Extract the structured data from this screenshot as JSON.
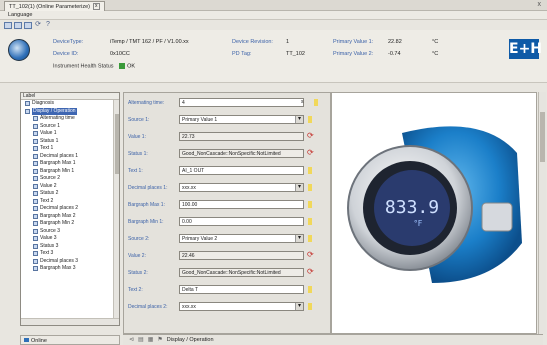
{
  "window": {
    "tab_title": "TT_102(1) (Online Parameterize)",
    "tab_close": "x",
    "close": "x"
  },
  "menu": {
    "language": "Language"
  },
  "header": {
    "device_type_label": "DeviceType:",
    "device_type_value": "iTemp / TMT 162 / PF / V1.00.xx",
    "device_id_label": "Device ID:",
    "device_id_value": "0x10CC",
    "health_label": "Instrument Health Status",
    "health_value": "OK",
    "revision_label": "Device Revision:",
    "revision_value": "1",
    "pd_tag_label": "PD Tag:",
    "pd_tag_value": "TT_102",
    "pv1_label": "Primary Value 1:",
    "pv1_value": "22.82",
    "pv1_unit": "°C",
    "pv2_label": "Primary Value 2:",
    "pv2_value": "-0.74",
    "pv2_unit": "°C",
    "logo": "E+H"
  },
  "tree": {
    "header": "Label",
    "items": [
      {
        "label": "Diagnosis",
        "level": 1
      },
      {
        "label": "Display / Operation",
        "level": 1,
        "selected": true
      },
      {
        "label": "Alternating time",
        "level": 2
      },
      {
        "label": "Source 1",
        "level": 2
      },
      {
        "label": "Value 1",
        "level": 2
      },
      {
        "label": "Status 1",
        "level": 2
      },
      {
        "label": "Text 1",
        "level": 2
      },
      {
        "label": "Decimal places 1",
        "level": 2
      },
      {
        "label": "Bargraph Max 1",
        "level": 2
      },
      {
        "label": "Bargraph Min 1",
        "level": 2
      },
      {
        "label": "Source 2",
        "level": 2
      },
      {
        "label": "Value 2",
        "level": 2
      },
      {
        "label": "Status 2",
        "level": 2
      },
      {
        "label": "Text 2",
        "level": 2
      },
      {
        "label": "Decimal places 2",
        "level": 2
      },
      {
        "label": "Bargraph Max 2",
        "level": 2
      },
      {
        "label": "Bargraph Min 2",
        "level": 2
      },
      {
        "label": "Source 3",
        "level": 2
      },
      {
        "label": "Value 3",
        "level": 2
      },
      {
        "label": "Status 3",
        "level": 2
      },
      {
        "label": "Text 3",
        "level": 2
      },
      {
        "label": "Decimal places 3",
        "level": 2
      },
      {
        "label": "Bargraph Max 3",
        "level": 2
      }
    ]
  },
  "form": {
    "alternating_time_label": "Alternating time:",
    "alternating_time_value": "4",
    "alternating_time_unit": "s",
    "source1_label": "Source 1:",
    "source1_value": "Primary Value 1",
    "value1_label": "Value 1:",
    "value1_value": "22.73",
    "status1_label": "Status 1:",
    "status1_value": "Good_NonCascade::NonSpecific:NotLimited",
    "text1_label": "Text 1:",
    "text1_value": "AI_1 OUT",
    "dec1_label": "Decimal places 1:",
    "dec1_value": "xxx.xx",
    "bgmax1_label": "Bargraph Max 1:",
    "bgmax1_value": "100.00",
    "bgmin1_label": "Bargraph Min 1:",
    "bgmin1_value": "0.00",
    "source2_label": "Source 2:",
    "source2_value": "Primary Value 2",
    "value2_label": "Value 2:",
    "value2_value": "22.46",
    "status2_label": "Status 2:",
    "status2_value": "Good_NonCascade::NonSpecific:NotLimited",
    "text2_label": "Text 2:",
    "text2_value": "Delta T",
    "dec2_label": "Decimal places 2:",
    "dec2_value": "xxx.xx"
  },
  "product_display": {
    "reading": "833.9",
    "unit": "°F"
  },
  "status": {
    "online": "Online",
    "breadcrumb": "Display / Operation"
  },
  "colors": {
    "label_blue": "#3c62a8",
    "accent_blue": "#0e5aa7",
    "ok_green": "#3a9a3a"
  }
}
